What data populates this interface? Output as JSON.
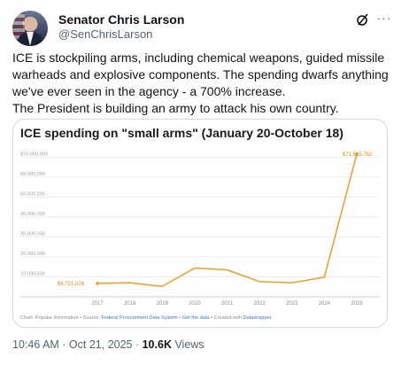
{
  "author": {
    "name": "Senator Chris Larson",
    "handle": "@SenChrisLarson"
  },
  "icons": {
    "grok": "grok-icon",
    "more": "more-icon"
  },
  "tweet": {
    "line1": "ICE is stockpiling arms, including chemical weapons, guided missile warheads and explosive components. The spending dwarfs anything we've ever seen in the agency - a 700% increase.",
    "line2": "The President is building an army to attack his own country."
  },
  "chart_data": {
    "type": "line",
    "title": "ICE spending on \"small arms\" (January 20-October 18)",
    "x": [
      "2017",
      "2018",
      "2019",
      "2020",
      "2021",
      "2022",
      "2023",
      "2024",
      "2025"
    ],
    "series": [
      {
        "values": [
          6721026,
          7000000,
          5200000,
          14400000,
          13500000,
          7600000,
          7000000,
          9800000,
          71515762
        ],
        "color": "#f0a02f"
      }
    ],
    "y_ticks": [
      "$70,000,000",
      "60,000,000",
      "50,000,000",
      "40,000,000",
      "30,000,000",
      "20,000,000",
      "10,000,000"
    ],
    "ylim": [
      0,
      75000000
    ],
    "annotations": {
      "first": "$6,721,026",
      "last": "$71,515,762"
    },
    "grid": true
  },
  "footer": {
    "prefix": "Chart: Popular Information • Source: ",
    "source": "Federal Procurement Data System",
    "sep": " • ",
    "get_data": "Get the data",
    "created": " • Created with ",
    "tool": "Datawrapper"
  },
  "meta": {
    "time": "10:46 AM · Oct 21, 2025 · ",
    "views_count": "10.6K",
    "views_label": " Views"
  }
}
